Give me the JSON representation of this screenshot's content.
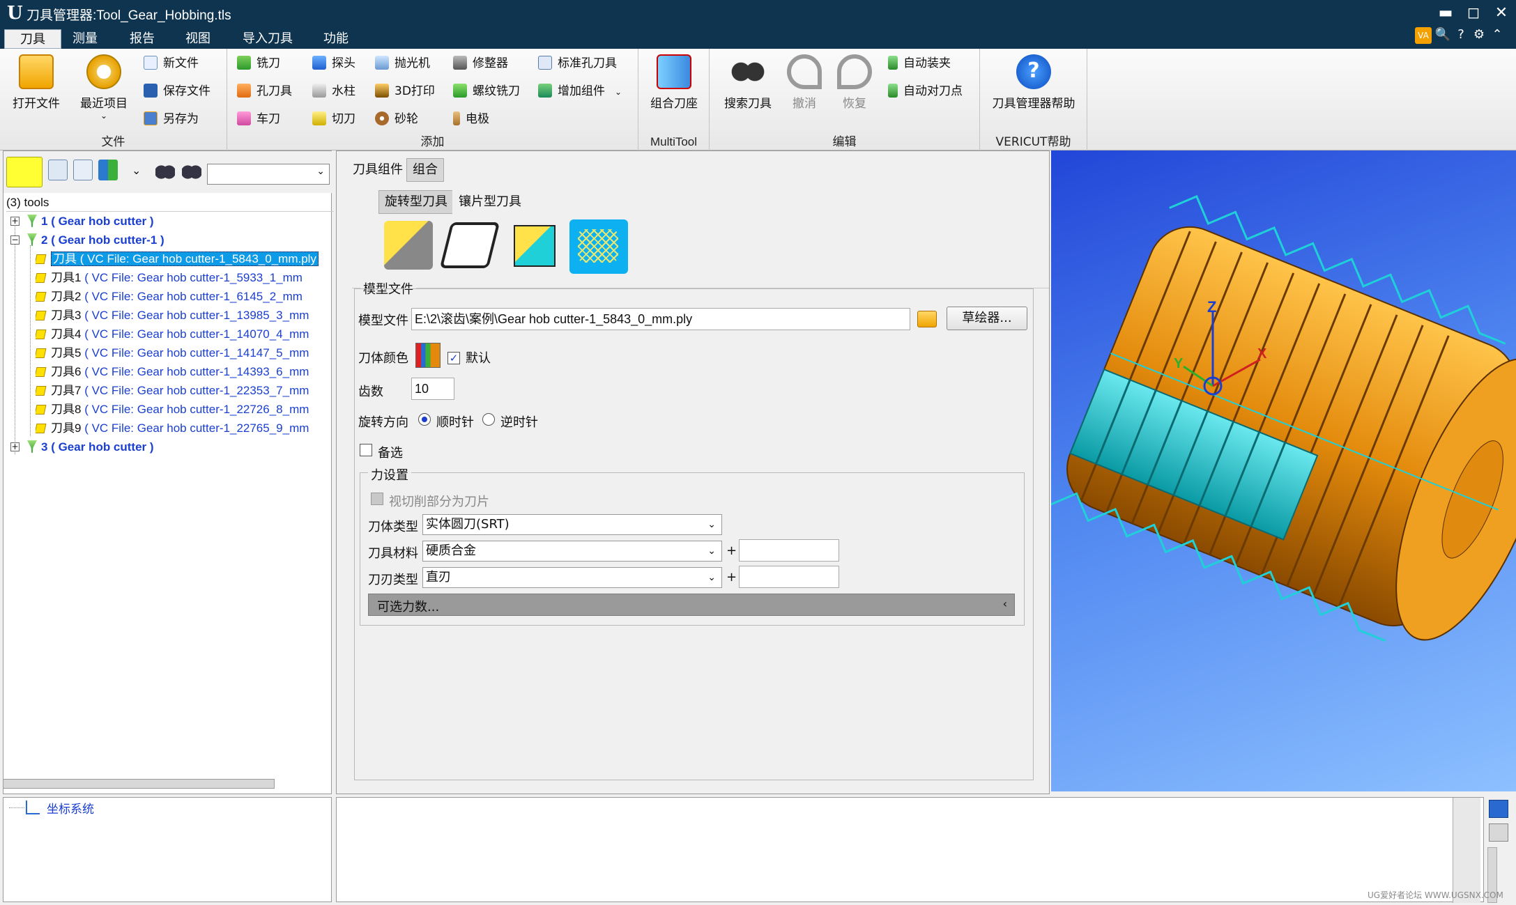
{
  "window": {
    "title": "刀具管理器:Tool_Gear_Hobbing.tls",
    "logo": "U",
    "minimize": "▬",
    "maximize": "◻",
    "close": "✕"
  },
  "menu": {
    "tabs": [
      "刀具",
      "测量",
      "报告",
      "视图",
      "导入刀具",
      "功能"
    ]
  },
  "top_icons": [
    "VA",
    "🔍",
    "?",
    "⚙",
    "⌃"
  ],
  "ribbon": {
    "file": {
      "open": "打开文件",
      "recent": "最近项目",
      "new": "新文件",
      "save": "保存文件",
      "saveas": "另存为",
      "label": "文件"
    },
    "add": {
      "label": "添加",
      "col1": [
        "铣刀",
        "孔刀具",
        "车刀"
      ],
      "col2": [
        "探头",
        "水柱",
        "切刀"
      ],
      "col3": [
        "抛光机",
        "3D打印",
        "砂轮"
      ],
      "col4": [
        "修整器",
        "螺纹铣刀",
        "电极"
      ],
      "col5": [
        "标准孔刀具",
        "增加组件"
      ]
    },
    "multitool": {
      "btn": "组合刀座",
      "label": "MultiTool"
    },
    "edit": {
      "search": "搜索刀具",
      "undo": "撤消",
      "redo": "恢复",
      "auto_clamp": "自动装夹",
      "auto_align": "自动对刀点",
      "label": "编辑"
    },
    "help": {
      "btn": "刀具管理器帮助",
      "label": "VERICUT帮助"
    }
  },
  "tree": {
    "root": "(3) tools",
    "nodes": [
      {
        "num": "1",
        "name": "( Gear hob cutter )"
      },
      {
        "num": "2",
        "name": "( Gear hob cutter-1 )"
      },
      {
        "num": "3",
        "name": "( Gear hob cutter )"
      }
    ],
    "leaves": [
      {
        "zh": "刀具",
        "text": " ( VC File: Gear hob cutter-1_5843_0_mm.ply"
      },
      {
        "zh": "刀具1",
        "text": " ( VC File: Gear hob cutter-1_5933_1_mm"
      },
      {
        "zh": "刀具2",
        "text": " ( VC File: Gear hob cutter-1_6145_2_mm"
      },
      {
        "zh": "刀具3",
        "text": " ( VC File: Gear hob cutter-1_13985_3_mm"
      },
      {
        "zh": "刀具4",
        "text": " ( VC File: Gear hob cutter-1_14070_4_mm"
      },
      {
        "zh": "刀具5",
        "text": " ( VC File: Gear hob cutter-1_14147_5_mm"
      },
      {
        "zh": "刀具6",
        "text": " ( VC File: Gear hob cutter-1_14393_6_mm"
      },
      {
        "zh": "刀具7",
        "text": " ( VC File: Gear hob cutter-1_22353_7_mm"
      },
      {
        "zh": "刀具8",
        "text": " ( VC File: Gear hob cutter-1_22726_8_mm"
      },
      {
        "zh": "刀具9",
        "text": " ( VC File: Gear hob cutter-1_22765_9_mm"
      }
    ],
    "bottom_item": "坐标系统"
  },
  "center": {
    "tabs": [
      "刀具组件",
      "组合"
    ],
    "subtabs": [
      "旋转型刀具",
      "镶片型刀具"
    ],
    "model_group": "模型文件",
    "model_label": "模型文件",
    "model_path": "E:\\2\\滚齿\\案例\\Gear hob cutter-1_5843_0_mm.ply",
    "sketch_btn": "草绘器...",
    "color_label": "刀体颜色",
    "default_label": "默认",
    "teeth_label": "齿数",
    "teeth_value": "10",
    "rotation_label": "旋转方向",
    "cw": "顺时针",
    "ccw": "逆时针",
    "alt_label": "备选",
    "force_group": "力设置",
    "force_chk": "视切削部分为刀片",
    "body_type_label": "刀体类型",
    "body_type": "实体圆刀(SRT)",
    "material_label": "刀具材料",
    "material": "硬质合金",
    "edge_label": "刀刃类型",
    "edge": "直刃",
    "plus": "+",
    "optional": "可选力数..."
  },
  "axes": {
    "x": "X",
    "y": "Y",
    "z": "Z"
  },
  "watermark": "UG爱好者论坛 WWW.UGSNX.COM",
  "colors": {
    "titlebar": "#0e3450",
    "select": "#0d9ae6",
    "hob": "#e38a0c",
    "cyan": "#1fd0d8"
  }
}
